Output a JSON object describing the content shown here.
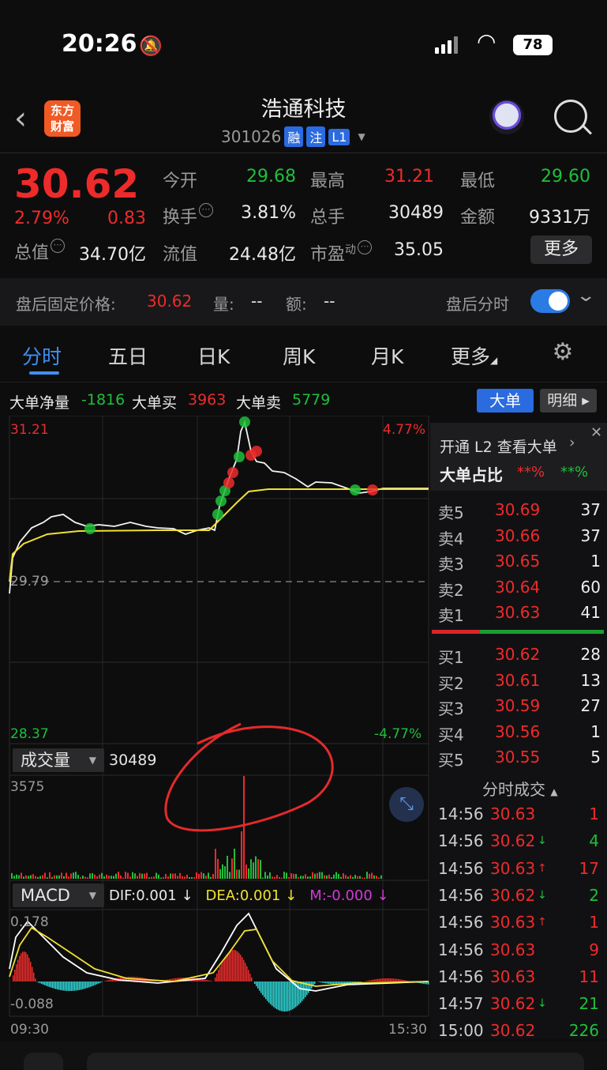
{
  "status": {
    "time": "20:26",
    "battery": "78"
  },
  "header": {
    "logo_line1": "东方",
    "logo_line2": "财富",
    "name": "浩通科技",
    "code": "301026",
    "tags": [
      "融",
      "注",
      "L1"
    ]
  },
  "quote": {
    "price": "30.62",
    "change_pct": "2.79%",
    "change": "0.83",
    "open_label": "今开",
    "open": "29.68",
    "high_label": "最高",
    "high": "31.21",
    "low_label": "最低",
    "low": "29.60",
    "turnover_label": "换手",
    "turnover": "3.81%",
    "vol_label": "总手",
    "vol": "30489",
    "amount_label": "金额",
    "amount": "9331万",
    "cap_label": "总值",
    "cap": "34.70亿",
    "float_label": "流值",
    "float": "24.48亿",
    "pe_label": "市盈",
    "pe_sup": "动",
    "pe": "35.05",
    "more_label": "更多"
  },
  "after_hours": {
    "label": "盘后固定价格:",
    "price": "30.62",
    "vol_label": "量:",
    "vol": "--",
    "amt_label": "额:",
    "amt": "--",
    "toggle_label": "盘后分时",
    "toggle_on": true
  },
  "tabs": [
    "分时",
    "五日",
    "日K",
    "周K",
    "月K",
    "更多"
  ],
  "big_orders": {
    "net_label": "大单净量",
    "net": "-1816",
    "buy_label": "大单买",
    "buy": "3963",
    "sell_label": "大单卖",
    "sell": "5779",
    "btn_big": "大单",
    "btn_detail": "明细"
  },
  "chart_labels": {
    "price_top": "31.21",
    "price_mid": "29.79",
    "price_bot": "28.37",
    "pct_top": "4.77%",
    "pct_bot": "-4.77%",
    "vol_btn": "成交量",
    "vol_val": "30489",
    "vol_max": "3575",
    "macd_btn": "MACD",
    "dif": "DIF:0.001",
    "dea": "DEA:0.001",
    "m": "M:-0.000",
    "macd_top": "0.178",
    "macd_bot": "-0.088",
    "t_start": "09:30",
    "t_end": "15:30"
  },
  "orderbook": {
    "l2_text": "开通 L2 查看大单",
    "ratio_label": "大单占比",
    "ratio_red": "**%",
    "ratio_green": "**%",
    "asks": [
      {
        "l": "卖5",
        "p": "30.69",
        "v": "37"
      },
      {
        "l": "卖4",
        "p": "30.66",
        "v": "37"
      },
      {
        "l": "卖3",
        "p": "30.65",
        "v": "1"
      },
      {
        "l": "卖2",
        "p": "30.64",
        "v": "60"
      },
      {
        "l": "卖1",
        "p": "30.63",
        "v": "41"
      }
    ],
    "bids": [
      {
        "l": "买1",
        "p": "30.62",
        "v": "28"
      },
      {
        "l": "买2",
        "p": "30.61",
        "v": "13"
      },
      {
        "l": "买3",
        "p": "30.59",
        "v": "27"
      },
      {
        "l": "买4",
        "p": "30.56",
        "v": "1"
      },
      {
        "l": "买5",
        "p": "30.55",
        "v": "5"
      }
    ],
    "ticks_title": "分时成交",
    "ticks": [
      {
        "t": "14:56",
        "p": "30.63",
        "a": "",
        "v": "1",
        "c": "red"
      },
      {
        "t": "14:56",
        "p": "30.62",
        "a": "↓",
        "v": "4",
        "c": "green"
      },
      {
        "t": "14:56",
        "p": "30.63",
        "a": "↑",
        "v": "17",
        "c": "red"
      },
      {
        "t": "14:56",
        "p": "30.62",
        "a": "↓",
        "v": "2",
        "c": "green"
      },
      {
        "t": "14:56",
        "p": "30.63",
        "a": "↑",
        "v": "1",
        "c": "red"
      },
      {
        "t": "14:56",
        "p": "30.63",
        "a": "",
        "v": "9",
        "c": "red"
      },
      {
        "t": "14:56",
        "p": "30.63",
        "a": "",
        "v": "11",
        "c": "red"
      },
      {
        "t": "14:57",
        "p": "30.62",
        "a": "↓",
        "v": "21",
        "c": "green"
      },
      {
        "t": "15:00",
        "p": "30.62",
        "a": "",
        "v": "226",
        "c": "green"
      }
    ]
  },
  "colors": {
    "up": "#ee2b2b",
    "down": "#1fbf3a",
    "accent": "#2a6be0"
  }
}
